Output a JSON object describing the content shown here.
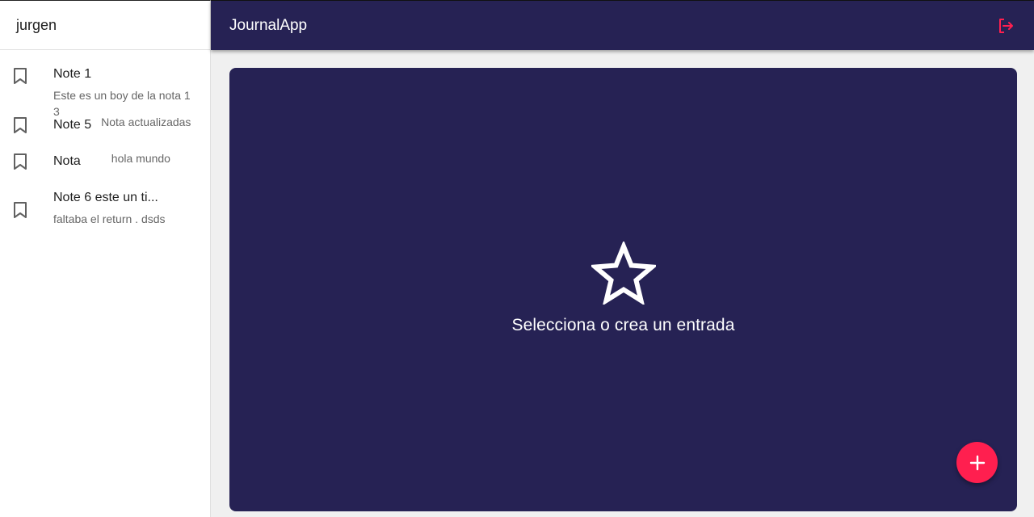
{
  "sidebar": {
    "username": "jurgen",
    "notes": [
      {
        "title": "Note 1",
        "body": "Este es un boy de la nota 1 3",
        "layout": "stacked"
      },
      {
        "title": "Note 5",
        "body": "Nota actualizadas",
        "layout": "inline"
      },
      {
        "title": "Nota",
        "body": "hola mundo",
        "layout": "inline"
      },
      {
        "title": "Note 6 este un ti...",
        "body": "faltaba el return . dsds",
        "layout": "stacked"
      }
    ],
    "note_icon": "bookmark-outline-icon"
  },
  "appbar": {
    "title": "JournalApp",
    "logout_icon": "logout-icon",
    "logout_color": "#ff1f4f"
  },
  "main": {
    "empty_icon": "star-outline-icon",
    "empty_message": "Selecciona o crea un entrada",
    "add_icon": "plus-icon"
  },
  "colors": {
    "primary": "#262254",
    "accent": "#ff1f4f"
  }
}
